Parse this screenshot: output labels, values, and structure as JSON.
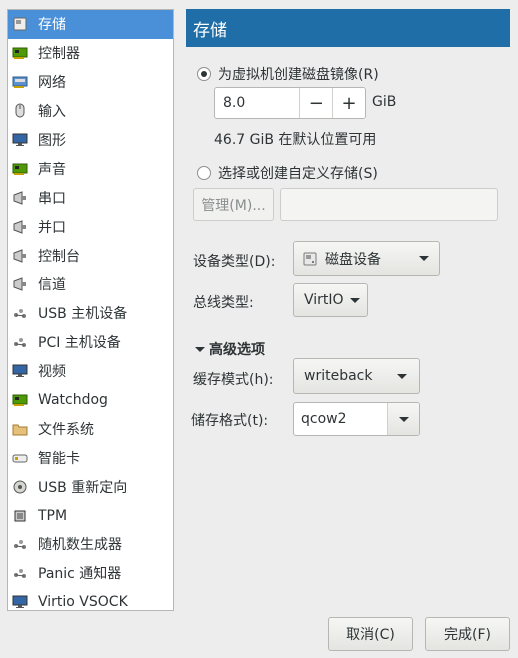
{
  "sidebar": {
    "items": [
      {
        "label": "存储",
        "icon": "disk-icon",
        "selected": true
      },
      {
        "label": "控制器",
        "icon": "controller-card-icon"
      },
      {
        "label": "网络",
        "icon": "network-icon"
      },
      {
        "label": "输入",
        "icon": "mouse-icon"
      },
      {
        "label": "图形",
        "icon": "monitor-icon"
      },
      {
        "label": "声音",
        "icon": "sound-card-icon"
      },
      {
        "label": "串口",
        "icon": "serial-port-icon"
      },
      {
        "label": "并口",
        "icon": "parallel-port-icon"
      },
      {
        "label": "控制台",
        "icon": "console-port-icon"
      },
      {
        "label": "信道",
        "icon": "channel-port-icon"
      },
      {
        "label": "USB 主机设备",
        "icon": "usb-host-icon"
      },
      {
        "label": "PCI 主机设备",
        "icon": "pci-host-icon"
      },
      {
        "label": "视频",
        "icon": "video-monitor-icon"
      },
      {
        "label": "Watchdog",
        "icon": "watchdog-card-icon"
      },
      {
        "label": "文件系统",
        "icon": "folder-icon"
      },
      {
        "label": "智能卡",
        "icon": "smartcard-icon"
      },
      {
        "label": "USB 重新定向",
        "icon": "usb-redirect-icon"
      },
      {
        "label": "TPM",
        "icon": "tpm-chip-icon"
      },
      {
        "label": "随机数生成器",
        "icon": "rng-icon"
      },
      {
        "label": "Panic 通知器",
        "icon": "panic-notifier-icon"
      },
      {
        "label": "Virtio VSOCK",
        "icon": "vsock-icon"
      }
    ]
  },
  "header": {
    "title": "存储"
  },
  "storage": {
    "create_image_label": "为虚拟机创建磁盘镜像(R)",
    "size_value": "8.0",
    "size_unit": "GiB",
    "available_text": "46.7 GiB 在默认位置可用",
    "custom_storage_label": "选择或创建自定义存储(S)",
    "manage_button": "管理(M)...",
    "path_value": ""
  },
  "device": {
    "device_type_label": "设备类型(D):",
    "device_type_value": "磁盘设备",
    "bus_type_label": "总线类型:",
    "bus_type_value": "VirtIO"
  },
  "advanced": {
    "title": "高级选项",
    "cache_mode_label": "缓存模式(h):",
    "cache_mode_value": "writeback",
    "storage_format_label": "储存格式(t):",
    "storage_format_value": "qcow2"
  },
  "footer": {
    "cancel_label": "取消(C)",
    "finish_label": "完成(F)"
  },
  "colors": {
    "header_bg": "#1f6ea8",
    "selection_bg": "#4a90d9"
  }
}
